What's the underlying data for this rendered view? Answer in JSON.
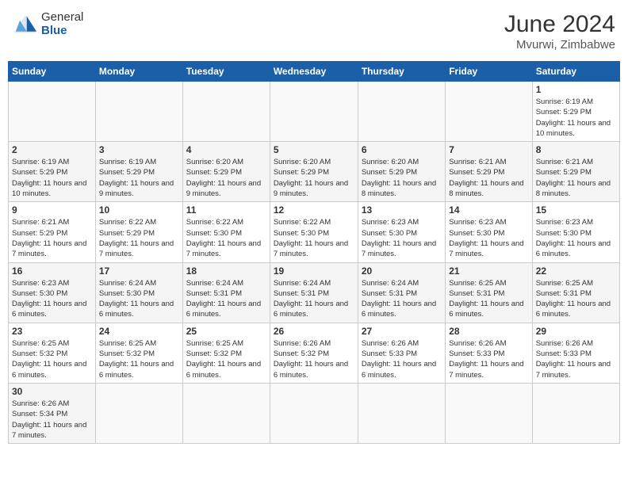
{
  "header": {
    "logo_general": "General",
    "logo_blue": "Blue",
    "month_year": "June 2024",
    "location": "Mvurwi, Zimbabwe"
  },
  "weekdays": [
    "Sunday",
    "Monday",
    "Tuesday",
    "Wednesday",
    "Thursday",
    "Friday",
    "Saturday"
  ],
  "weeks": [
    [
      {
        "day": "",
        "info": ""
      },
      {
        "day": "",
        "info": ""
      },
      {
        "day": "",
        "info": ""
      },
      {
        "day": "",
        "info": ""
      },
      {
        "day": "",
        "info": ""
      },
      {
        "day": "",
        "info": ""
      },
      {
        "day": "1",
        "info": "Sunrise: 6:19 AM\nSunset: 5:29 PM\nDaylight: 11 hours and 10 minutes."
      }
    ],
    [
      {
        "day": "2",
        "info": "Sunrise: 6:19 AM\nSunset: 5:29 PM\nDaylight: 11 hours and 10 minutes."
      },
      {
        "day": "3",
        "info": "Sunrise: 6:19 AM\nSunset: 5:29 PM\nDaylight: 11 hours and 9 minutes."
      },
      {
        "day": "4",
        "info": "Sunrise: 6:20 AM\nSunset: 5:29 PM\nDaylight: 11 hours and 9 minutes."
      },
      {
        "day": "5",
        "info": "Sunrise: 6:20 AM\nSunset: 5:29 PM\nDaylight: 11 hours and 9 minutes."
      },
      {
        "day": "6",
        "info": "Sunrise: 6:20 AM\nSunset: 5:29 PM\nDaylight: 11 hours and 8 minutes."
      },
      {
        "day": "7",
        "info": "Sunrise: 6:21 AM\nSunset: 5:29 PM\nDaylight: 11 hours and 8 minutes."
      },
      {
        "day": "8",
        "info": "Sunrise: 6:21 AM\nSunset: 5:29 PM\nDaylight: 11 hours and 8 minutes."
      }
    ],
    [
      {
        "day": "9",
        "info": "Sunrise: 6:21 AM\nSunset: 5:29 PM\nDaylight: 11 hours and 7 minutes."
      },
      {
        "day": "10",
        "info": "Sunrise: 6:22 AM\nSunset: 5:29 PM\nDaylight: 11 hours and 7 minutes."
      },
      {
        "day": "11",
        "info": "Sunrise: 6:22 AM\nSunset: 5:30 PM\nDaylight: 11 hours and 7 minutes."
      },
      {
        "day": "12",
        "info": "Sunrise: 6:22 AM\nSunset: 5:30 PM\nDaylight: 11 hours and 7 minutes."
      },
      {
        "day": "13",
        "info": "Sunrise: 6:23 AM\nSunset: 5:30 PM\nDaylight: 11 hours and 7 minutes."
      },
      {
        "day": "14",
        "info": "Sunrise: 6:23 AM\nSunset: 5:30 PM\nDaylight: 11 hours and 7 minutes."
      },
      {
        "day": "15",
        "info": "Sunrise: 6:23 AM\nSunset: 5:30 PM\nDaylight: 11 hours and 6 minutes."
      }
    ],
    [
      {
        "day": "16",
        "info": "Sunrise: 6:23 AM\nSunset: 5:30 PM\nDaylight: 11 hours and 6 minutes."
      },
      {
        "day": "17",
        "info": "Sunrise: 6:24 AM\nSunset: 5:30 PM\nDaylight: 11 hours and 6 minutes."
      },
      {
        "day": "18",
        "info": "Sunrise: 6:24 AM\nSunset: 5:31 PM\nDaylight: 11 hours and 6 minutes."
      },
      {
        "day": "19",
        "info": "Sunrise: 6:24 AM\nSunset: 5:31 PM\nDaylight: 11 hours and 6 minutes."
      },
      {
        "day": "20",
        "info": "Sunrise: 6:24 AM\nSunset: 5:31 PM\nDaylight: 11 hours and 6 minutes."
      },
      {
        "day": "21",
        "info": "Sunrise: 6:25 AM\nSunset: 5:31 PM\nDaylight: 11 hours and 6 minutes."
      },
      {
        "day": "22",
        "info": "Sunrise: 6:25 AM\nSunset: 5:31 PM\nDaylight: 11 hours and 6 minutes."
      }
    ],
    [
      {
        "day": "23",
        "info": "Sunrise: 6:25 AM\nSunset: 5:32 PM\nDaylight: 11 hours and 6 minutes."
      },
      {
        "day": "24",
        "info": "Sunrise: 6:25 AM\nSunset: 5:32 PM\nDaylight: 11 hours and 6 minutes."
      },
      {
        "day": "25",
        "info": "Sunrise: 6:25 AM\nSunset: 5:32 PM\nDaylight: 11 hours and 6 minutes."
      },
      {
        "day": "26",
        "info": "Sunrise: 6:26 AM\nSunset: 5:32 PM\nDaylight: 11 hours and 6 minutes."
      },
      {
        "day": "27",
        "info": "Sunrise: 6:26 AM\nSunset: 5:33 PM\nDaylight: 11 hours and 6 minutes."
      },
      {
        "day": "28",
        "info": "Sunrise: 6:26 AM\nSunset: 5:33 PM\nDaylight: 11 hours and 7 minutes."
      },
      {
        "day": "29",
        "info": "Sunrise: 6:26 AM\nSunset: 5:33 PM\nDaylight: 11 hours and 7 minutes."
      }
    ],
    [
      {
        "day": "30",
        "info": "Sunrise: 6:26 AM\nSunset: 5:34 PM\nDaylight: 11 hours and 7 minutes."
      },
      {
        "day": "",
        "info": ""
      },
      {
        "day": "",
        "info": ""
      },
      {
        "day": "",
        "info": ""
      },
      {
        "day": "",
        "info": ""
      },
      {
        "day": "",
        "info": ""
      },
      {
        "day": "",
        "info": ""
      }
    ]
  ]
}
